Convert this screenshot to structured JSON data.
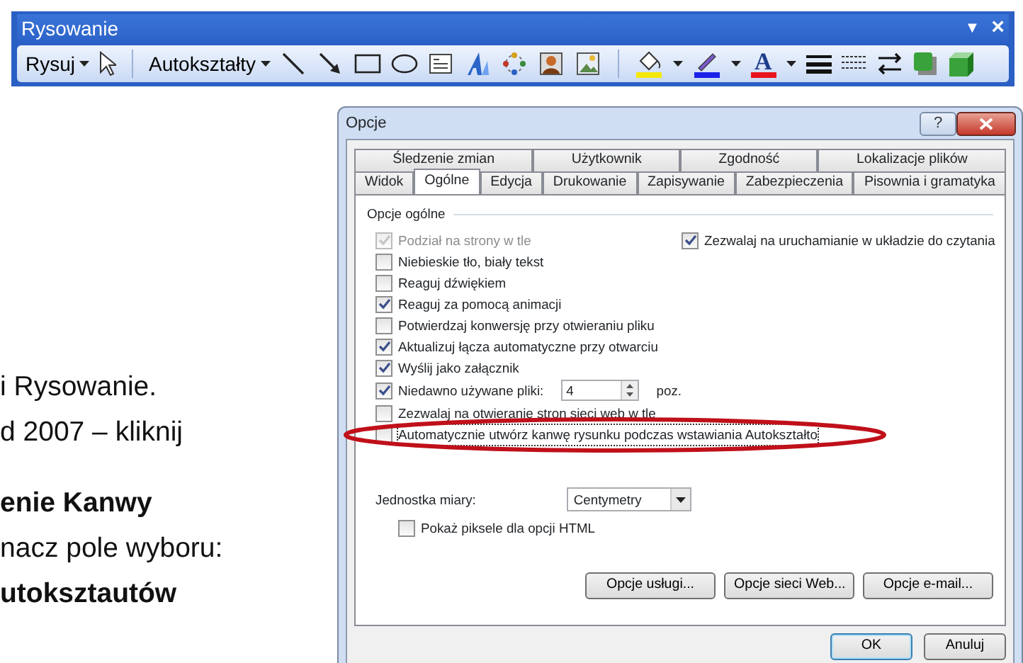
{
  "toolbar": {
    "title": "Rysowanie",
    "title_buttons": [
      {
        "kind": "dropdown",
        "label": "▼"
      },
      {
        "kind": "close",
        "label": "×"
      }
    ],
    "menus": [
      {
        "label": "Rysuj"
      },
      {
        "label": "Autokształty"
      }
    ],
    "font_color_letter": "A"
  },
  "document_text": [
    {
      "lines": [
        {
          "text": "i Rysowanie.",
          "bold": false
        },
        {
          "text": "d 2007 – kliknij",
          "bold": false
        }
      ]
    },
    {
      "lines": [
        {
          "text": "enie Kanwy",
          "bold": true
        },
        {
          "text": "nacz pole wyboru:",
          "bold": false
        },
        {
          "text": "utoksztautów",
          "bold": true
        }
      ]
    }
  ],
  "dialog": {
    "title": "Opcje",
    "help": "?",
    "tab_rows": [
      [
        {
          "label": "Śledzenie zmian",
          "selected": false
        },
        {
          "label": "Użytkownik",
          "selected": false
        },
        {
          "label": "Zgodność",
          "selected": false
        },
        {
          "label": "Lokalizacje plików",
          "selected": false
        }
      ],
      [
        {
          "label": "Widok",
          "selected": false
        },
        {
          "label": "Ogólne",
          "selected": true
        },
        {
          "label": "Edycja",
          "selected": false
        },
        {
          "label": "Drukowanie",
          "selected": false
        },
        {
          "label": "Zapisywanie",
          "selected": false
        },
        {
          "label": "Zabezpieczenia",
          "selected": false
        },
        {
          "label": "Pisownia i gramatyka",
          "selected": false
        }
      ]
    ],
    "section": "Opcje ogólne",
    "options_left": [
      {
        "kind": "checkbox",
        "label": "Podział na strony w tle",
        "checked": true,
        "disabled": true
      },
      {
        "kind": "checkbox",
        "label": "Niebieskie tło, biały tekst",
        "checked": false,
        "disabled": false
      },
      {
        "kind": "checkbox",
        "label": "Reaguj dźwiękiem",
        "checked": false,
        "disabled": false
      },
      {
        "kind": "checkbox",
        "label": "Reaguj za pomocą animacji",
        "checked": true,
        "disabled": false
      },
      {
        "kind": "checkbox",
        "label": "Potwierdzaj konwersję przy otwieraniu pliku",
        "checked": false,
        "disabled": false
      },
      {
        "kind": "checkbox",
        "label": "Aktualizuj łącza automatyczne przy otwarciu",
        "checked": true,
        "disabled": false
      },
      {
        "kind": "checkbox",
        "label": "Wyślij jako załącznik",
        "checked": true,
        "disabled": false
      },
      {
        "kind": "spin",
        "label": "Niedawno używane pliki:",
        "checked": true,
        "disabled": false,
        "value": "4",
        "unit": "poz."
      },
      {
        "kind": "checkbox",
        "label": "Zezwalaj na otwieranie stron sieci web w tle",
        "checked": false,
        "disabled": false
      },
      {
        "kind": "checkbox",
        "label": "Automatycznie utwórz kanwę rysunku podczas wstawiania Autokształto",
        "checked": false,
        "disabled": false,
        "focused": true
      }
    ],
    "options_right": [
      {
        "label": "Zezwalaj na uruchamianie w układzie do czytania",
        "checked": true
      }
    ],
    "measure": {
      "label": "Jednostka miary:",
      "value": "Centymetry"
    },
    "html_pixels": {
      "label": "Pokaż piksele dla opcji HTML",
      "checked": false
    },
    "service_buttons": [
      "Opcje usługi...",
      "Opcje sieci Web...",
      "Opcje e-mail..."
    ],
    "footer_buttons": [
      {
        "label": "OK",
        "default": true
      },
      {
        "label": "Anuluj",
        "default": false
      }
    ]
  }
}
